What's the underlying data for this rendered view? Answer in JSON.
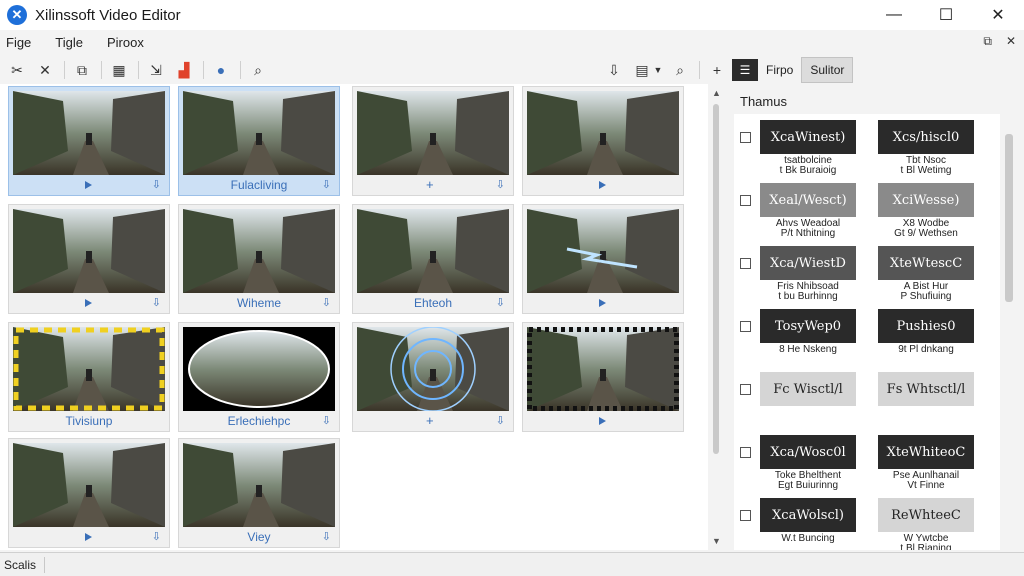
{
  "window": {
    "title": "Xilinssoft Video Editor",
    "minimize_glyph": "—",
    "maximize_glyph": "☐",
    "close_glyph": "✕"
  },
  "menu": {
    "items": [
      "Fige",
      "Tigle",
      "Piroox"
    ],
    "right_glyphs": [
      "⧉",
      "✕"
    ]
  },
  "toolbar": {
    "left_icons": [
      "cut-icon",
      "close-icon",
      "copy-icon",
      "film-icon",
      "export-icon",
      "effects-icon",
      "info-icon",
      "search-icon"
    ],
    "right_icons": [
      "download-icon",
      "format-icon",
      "zoom-icon",
      "add-icon"
    ]
  },
  "grid": {
    "tiles": [
      {
        "label": "",
        "footer": "play",
        "selected": true
      },
      {
        "label": "Fulacliving",
        "footer": "label",
        "selected": true
      },
      {
        "label": "",
        "footer": "plus",
        "selected": false
      },
      {
        "label": "",
        "footer": "play",
        "selected": false
      },
      {
        "label": "",
        "footer": "play",
        "selected": false
      },
      {
        "label": "Wiheme",
        "footer": "label",
        "selected": false
      },
      {
        "label": "Ehteoh",
        "footer": "label",
        "selected": false
      },
      {
        "label": "",
        "footer": "play",
        "selected": false
      },
      {
        "label": "Tivisiunp",
        "footer": "label",
        "selected": false
      },
      {
        "label": "Erlechiehpc",
        "footer": "label",
        "selected": false
      },
      {
        "label": "",
        "footer": "plus",
        "selected": false
      },
      {
        "label": "",
        "footer": "play",
        "selected": false
      },
      {
        "label": "",
        "footer": "play",
        "selected": false
      },
      {
        "label": "Viey",
        "footer": "label",
        "selected": false
      }
    ]
  },
  "panel": {
    "tabs": [
      "Firpo",
      "Sulitor"
    ],
    "heading": "Thamus",
    "presets": [
      {
        "a_title": "XcaWinest)",
        "a_cap": "tsatbolcine\nt Bk Buraioig",
        "b_title": "Xcs/hiscl0",
        "b_cap": "Tbt Nsoc\nt Bl Wetimg",
        "a_style": "dark",
        "b_style": "dark"
      },
      {
        "a_title": "Xeal/Wesct)",
        "a_cap": "Ahvs Weadoal\nP/t Nthitning",
        "b_title": "XciWesse)",
        "b_cap": "X8 Wodbe\nGt 9/ Wethsen",
        "a_style": "mid",
        "b_style": "mid"
      },
      {
        "a_title": "Xca/WiestD",
        "a_cap": "Fris Nhibsoad\nt bu Burhinng",
        "b_title": "XteWtescC",
        "b_cap": "A Bist Hur\nP Shufiuing",
        "a_style": "noisy",
        "b_style": "noisy"
      },
      {
        "a_title": "TosyWep0",
        "a_cap": "8 He Nskeng",
        "b_title": "Pushies0",
        "b_cap": "9t Pl dnkang",
        "a_style": "dark",
        "b_style": "dark"
      },
      {
        "a_title": "Fc Wisctl/l",
        "a_cap": "",
        "b_title": "Fs Whtsctl/l",
        "b_cap": "",
        "a_style": "light",
        "b_style": "light"
      },
      {
        "a_title": "Xca/Wosc0l",
        "a_cap": "Toke Bhelthent\nEgt Buiurinng",
        "b_title": "XteWhiteoC",
        "b_cap": "Pse Aunlhanail\nVt Finne",
        "a_style": "dark",
        "b_style": "dark"
      },
      {
        "a_title": "XcaWolscl)",
        "a_cap": "W.t Buncing",
        "b_title": "ReWhteeC",
        "b_cap": "W Ywtcbe\nt Bl Rianing",
        "a_style": "dark",
        "b_style": "light"
      }
    ]
  },
  "status": {
    "text": "Scalis"
  }
}
